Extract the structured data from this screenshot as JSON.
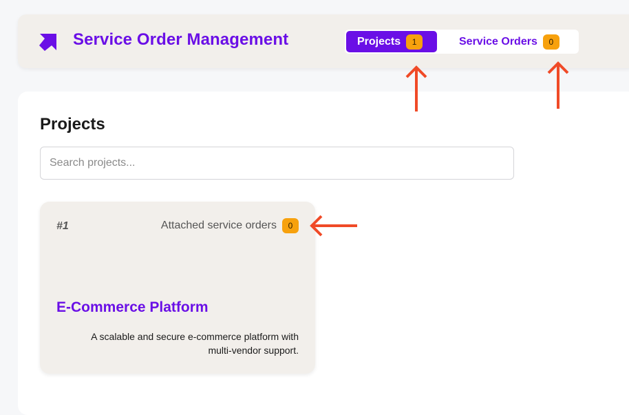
{
  "header": {
    "app_title": "Service Order Management",
    "logo_icon": "arrow-up-right-icon",
    "accent_color": "#6a0fe6",
    "tabs": [
      {
        "label": "Projects",
        "count": "1",
        "active": true
      },
      {
        "label": "Service Orders",
        "count": "0",
        "active": false
      }
    ]
  },
  "main": {
    "section_title": "Projects",
    "search": {
      "placeholder": "Search projects...",
      "value": ""
    },
    "projects": [
      {
        "id": "#1",
        "attached_label": "Attached service orders",
        "attached_count": "0",
        "name": "E-Commerce Platform",
        "description": "A scalable and secure e-commerce platform with multi-vendor support."
      }
    ]
  },
  "colors": {
    "badge": "#f7a10d",
    "annotation_arrow": "#f04a27",
    "header_bg": "#f2efeb"
  }
}
